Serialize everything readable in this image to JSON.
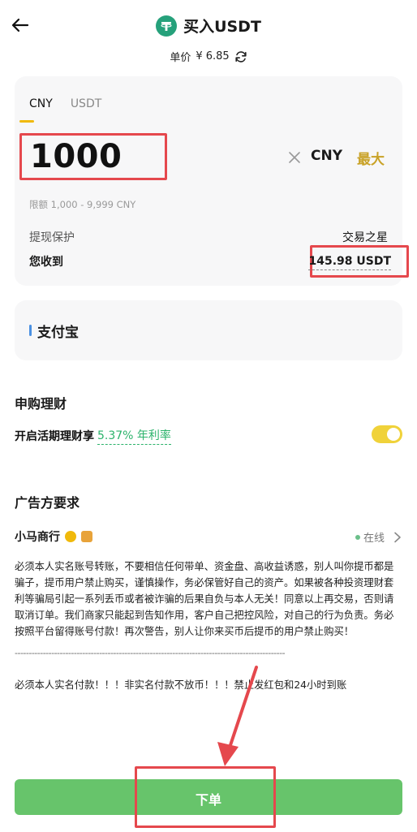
{
  "header": {
    "title": "买入USDT",
    "price_label": "单价",
    "price_value": "¥ 6.85"
  },
  "tabs": [
    {
      "label": "CNY",
      "active": true
    },
    {
      "label": "USDT",
      "active": false
    }
  ],
  "amount": {
    "value": "1000",
    "unit": "CNY",
    "max_label": "最大",
    "limit": "限额 1,000 - 9,999 CNY"
  },
  "withdraw": {
    "label": "提现保护",
    "value": "交易之星"
  },
  "receive": {
    "label": "您收到",
    "value": "145.98 USDT"
  },
  "payment": {
    "method": "支付宝"
  },
  "subscription": {
    "title": "申购理财",
    "earn_label": "开启活期理财享",
    "earn_rate": "5.37% 年利率",
    "toggle_on": true
  },
  "advertiser": {
    "section_title": "广告方要求",
    "merchant_name": "小马商行",
    "status": "在线",
    "terms": "必须本人实名账号转账，不要相信任何带单、资金盘、高收益诱惑，别人叫你提币都是骗子，提币用户禁止购买，谨慎操作，务必保管好自己的资产。如果被各种投资理财套利等骗局引起一系列丢币或者被诈骗的后果自负与本人无关！同意以上再交易，否则请取消订单。我们商家只能起到告知作用，客户自己把控风险，对自己的行为负责。务必按照平台留得账号付款！再次警告，别人让你来买币后提币的用户禁止购买！",
    "divider": "------------------------------------------------------------------------------------------------",
    "notice": "必须本人实名付款！！！非实名付款不放币！！！禁止发红包和24小时到账"
  },
  "footer": {
    "order_label": "下单"
  },
  "colors": {
    "accent_green": "#67c46b",
    "highlight_red": "#e5484d",
    "max_gold": "#c9a227",
    "rate_green": "#2bb36b",
    "toggle_yellow": "#f0d23a"
  }
}
